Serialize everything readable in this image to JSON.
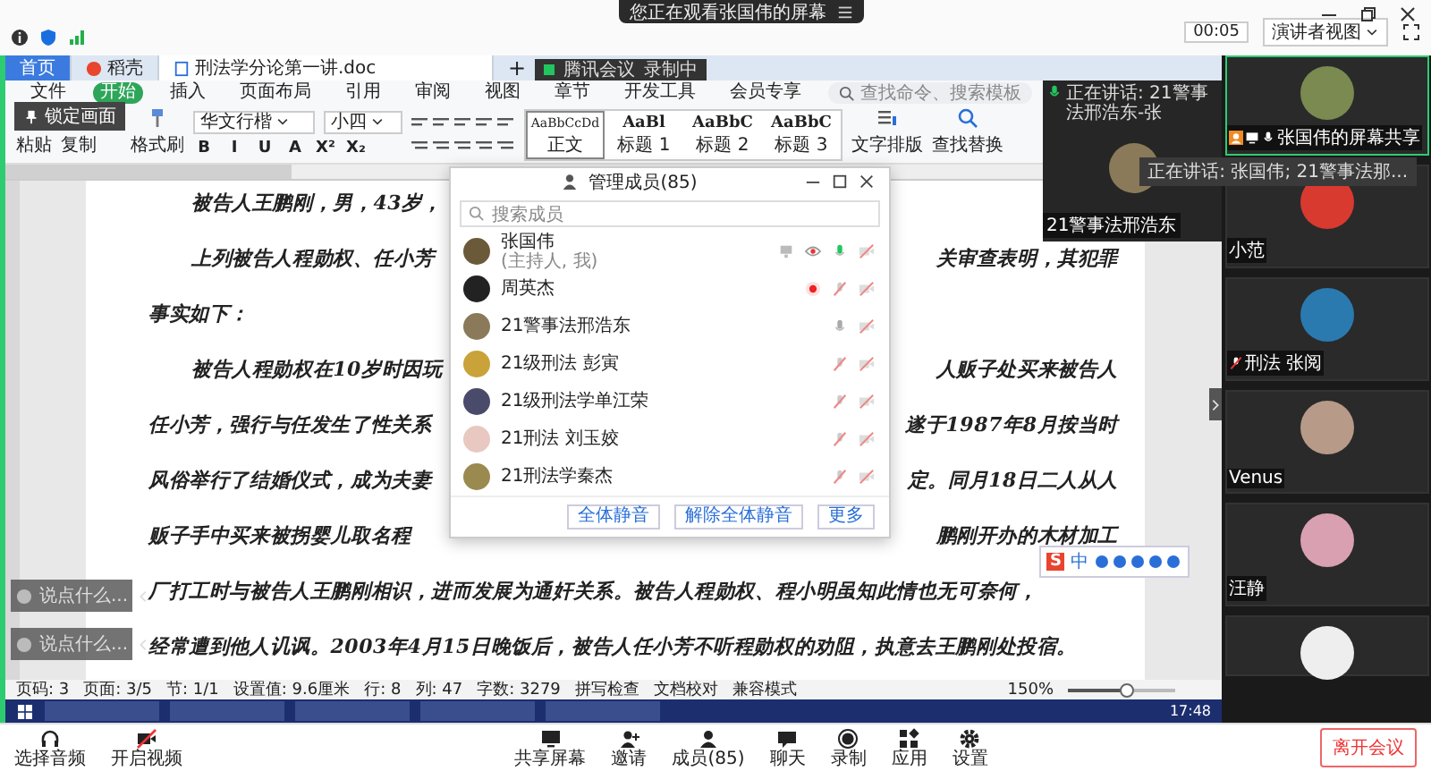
{
  "viewer_bar": {
    "notice": "您正在观看张国伟的屏幕",
    "timer": "00:05",
    "view_mode": "演讲者视图"
  },
  "wps": {
    "tabs": [
      {
        "label": "首页",
        "kind": "home",
        "selected": false
      },
      {
        "label": "稻壳",
        "kind": "docer",
        "selected": false
      },
      {
        "label": "刑法学分论第一讲.doc",
        "kind": "doc",
        "selected": true
      }
    ],
    "new_tab": "+",
    "meeting_badge": {
      "name": "腾讯会议",
      "recording": "录制中"
    },
    "menu": [
      {
        "label": "文件",
        "selected": false
      },
      {
        "label": "开始",
        "selected": true
      },
      {
        "label": "插入",
        "selected": false
      },
      {
        "label": "页面布局",
        "selected": false
      },
      {
        "label": "引用",
        "selected": false
      },
      {
        "label": "审阅",
        "selected": false
      },
      {
        "label": "视图",
        "selected": false
      },
      {
        "label": "章节",
        "selected": false
      },
      {
        "label": "开发工具",
        "selected": false
      },
      {
        "label": "会员专享",
        "selected": false
      }
    ],
    "command_search": {
      "placeholder": "查找命令、搜索模板"
    },
    "ribbon": {
      "paste": "粘贴",
      "copy": "复制",
      "format_painter": "格式刷",
      "font": "华文行楷",
      "size": "小四",
      "format_buttons": [
        "B",
        "I",
        "U",
        "A",
        "X²",
        "X₂"
      ],
      "styles": [
        {
          "sample": "AaBbCcDd",
          "label": "正文",
          "selected": true
        },
        {
          "sample": "AaBl",
          "label": "标题 1",
          "selected": false
        },
        {
          "sample": "AaBbC",
          "label": "标题 2",
          "selected": false
        },
        {
          "sample": "AaBbC",
          "label": "标题 3",
          "selected": false
        }
      ],
      "layout": "文字排版",
      "find": "查找替换"
    },
    "lock_tip": "锁定画面",
    "document": {
      "lines": [
        {
          "left": "被告人王鹏刚，男，43岁，",
          "indent": true
        },
        {
          "left": "上列被告人程勋权、任小芳",
          "right": "关审查表明，其犯罪",
          "indent": true
        },
        {
          "left": "事实如下：",
          "indent": false
        },
        {
          "left": "被告人程勋权在10岁时因玩",
          "right": "人贩子处买来被告人",
          "indent": true
        },
        {
          "left": "任小芳，强行与任发生了性关系",
          "right": "遂于1987年8月按当时",
          "indent": false
        },
        {
          "left": "风俗举行了结婚仪式，成为夫妻",
          "right": "定。同月18日二人从人",
          "indent": false
        },
        {
          "left": "贩子手中买来被拐婴儿取名程",
          "right": "鹏刚开办的木材加工",
          "indent": false
        },
        {
          "left": "厂打工时与被告人王鹏刚相识，进而发展为通奸关系。被告人程勋权、程小明虽知此情也无可奈何，",
          "indent": false
        },
        {
          "left": "经常遭到他人讥讽。2003年4月15日晚饭后，被告人任小芳不听程勋权的劝阻，执意去王鹏刚处投宿。",
          "indent": false
        }
      ]
    },
    "status": [
      "页码: 3",
      "页面: 3/5",
      "节: 1/1",
      "设置值: 9.6厘米",
      "行: 8",
      "列: 47",
      "字数: 3279"
    ],
    "status_tools": [
      "拼写检查",
      "文档校对",
      "兼容模式"
    ],
    "zoom": {
      "label": "150%",
      "level": 0.55
    },
    "taskbar": {
      "clock": "17:48"
    },
    "chat_inputs": [
      {
        "placeholder": "说点什么..."
      },
      {
        "placeholder": "说点什么..."
      }
    ],
    "ime": {
      "logo": "S",
      "mode": "中"
    },
    "speaker_window": {
      "speaking": "正在讲话: 21警事法邢浩东-张",
      "name": "21警事法邢浩东"
    }
  },
  "members_panel": {
    "title": "管理成员(85)",
    "search": {
      "placeholder": "搜索成员"
    },
    "members": [
      {
        "name": "张国伟",
        "note": "(主持人, 我)",
        "speaking": true,
        "muted": false,
        "sharing": true,
        "viewing": true,
        "recording": false,
        "camera_on": false
      },
      {
        "name": "周英杰",
        "speaking": false,
        "muted": true,
        "sharing": false,
        "viewing": false,
        "recording": true,
        "camera_on": false
      },
      {
        "name": "21警事法邢浩东",
        "speaking": false,
        "muted": false,
        "sharing": false,
        "viewing": false,
        "recording": false,
        "camera_on": false
      },
      {
        "name": "21级刑法 彭寅",
        "speaking": false,
        "muted": true,
        "sharing": false,
        "viewing": false,
        "recording": false,
        "camera_on": false
      },
      {
        "name": "21级刑法学单江荣",
        "speaking": false,
        "muted": true,
        "sharing": false,
        "viewing": false,
        "recording": false,
        "camera_on": false
      },
      {
        "name": "21刑法 刘玉姣",
        "speaking": false,
        "muted": true,
        "sharing": false,
        "viewing": false,
        "recording": false,
        "camera_on": false
      },
      {
        "name": "21刑法学秦杰",
        "speaking": false,
        "muted": true,
        "sharing": false,
        "viewing": false,
        "recording": false,
        "camera_on": false
      }
    ],
    "buttons": [
      "全体静音",
      "解除全体静音",
      "更多"
    ]
  },
  "video_tiles": [
    {
      "name": "张国伟的屏幕共享",
      "host": true,
      "sharing": true,
      "speaking": true,
      "muted": false
    },
    {
      "name": "小范",
      "host": false,
      "sharing": false,
      "speaking": false,
      "muted": false
    },
    {
      "name": "刑法 张阅",
      "host": false,
      "sharing": false,
      "speaking": false,
      "muted": true
    },
    {
      "name": "Venus",
      "host": false,
      "sharing": false,
      "speaking": false,
      "muted": false
    },
    {
      "name": "汪静",
      "host": false,
      "sharing": false,
      "speaking": false,
      "muted": false
    },
    {
      "host": false,
      "sharing": false,
      "speaking": false,
      "muted": false
    }
  ],
  "speaking_banner": "正在讲话: 张国伟; 21警事法那...",
  "toolbar": {
    "left": [
      {
        "label": "选择音频",
        "kind": "audio"
      },
      {
        "label": "开启视频",
        "kind": "video"
      }
    ],
    "center": [
      {
        "label": "共享屏幕",
        "kind": "share"
      },
      {
        "label": "邀请",
        "kind": "invite"
      },
      {
        "label": "成员(85)",
        "kind": "members"
      },
      {
        "label": "聊天",
        "kind": "chat"
      },
      {
        "label": "录制",
        "kind": "record"
      },
      {
        "label": "应用",
        "kind": "apps"
      },
      {
        "label": "设置",
        "kind": "settings"
      }
    ],
    "leave": "离开会议"
  }
}
